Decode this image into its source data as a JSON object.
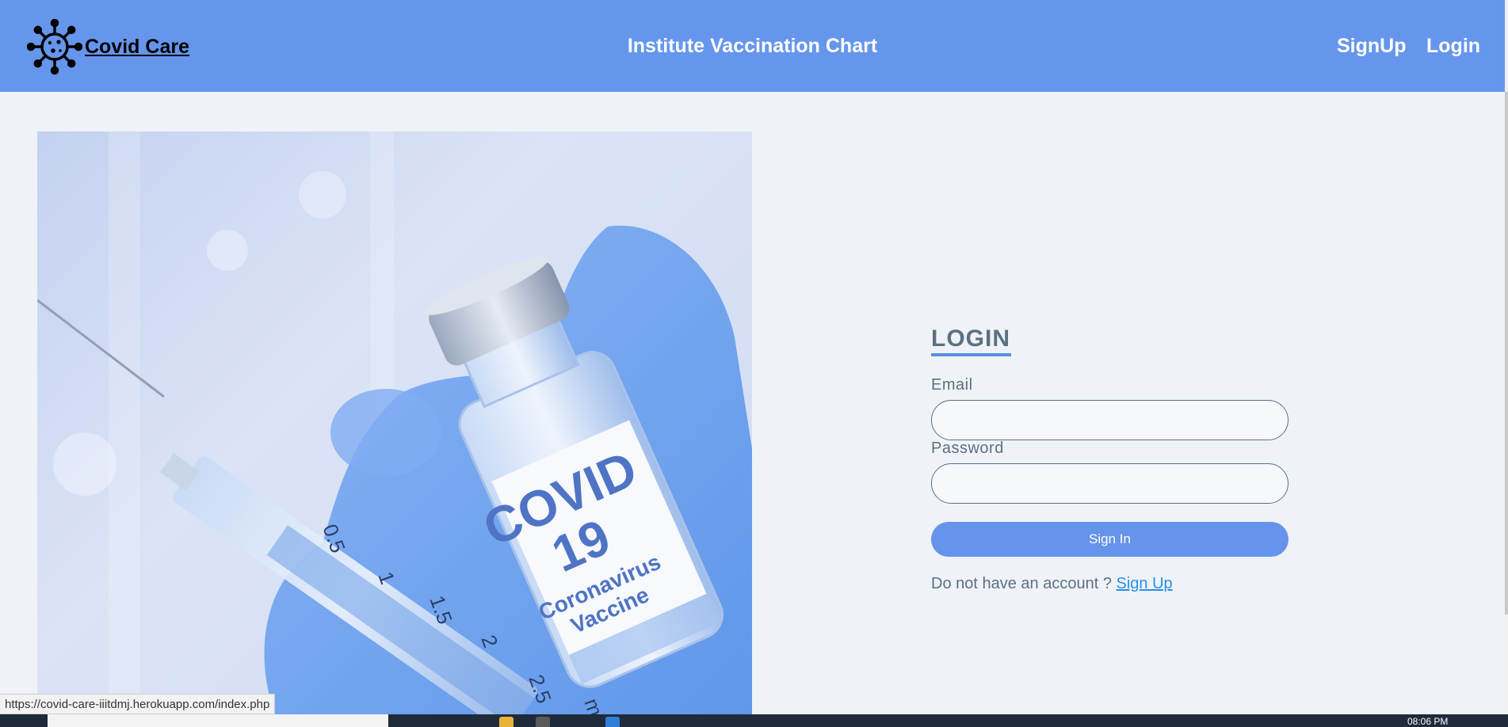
{
  "browser": {
    "status_url": "https://covid-care-iiitdmj.herokuapp.com/index.php"
  },
  "header": {
    "brand": "Covid Care",
    "brand_icon": "virus-icon",
    "title": "Institute Vaccination Chart",
    "nav": [
      {
        "label": "SignUp"
      },
      {
        "label": "Login"
      }
    ]
  },
  "hero": {
    "label_line1": "COVID",
    "label_line2": "19",
    "label_line3": "Coronavirus",
    "label_line4": "Vaccine",
    "syringe_marks": [
      "0.5",
      "1",
      "1.5",
      "2",
      "2.5",
      "ml"
    ]
  },
  "login": {
    "heading": "LOGIN",
    "email_label": "Email",
    "email_value": "",
    "password_label": "Password",
    "password_value": "",
    "submit_label": "Sign In",
    "no_account_text": "Do not have an account ?",
    "signup_link": "Sign Up"
  },
  "taskbar": {
    "clock": "08:06 PM"
  },
  "colors": {
    "header_bg": "#6696ec",
    "page_bg": "#eff3f7",
    "button_bg": "#6693ec",
    "text_muted": "#5b7082",
    "link": "#2a8fe9"
  }
}
